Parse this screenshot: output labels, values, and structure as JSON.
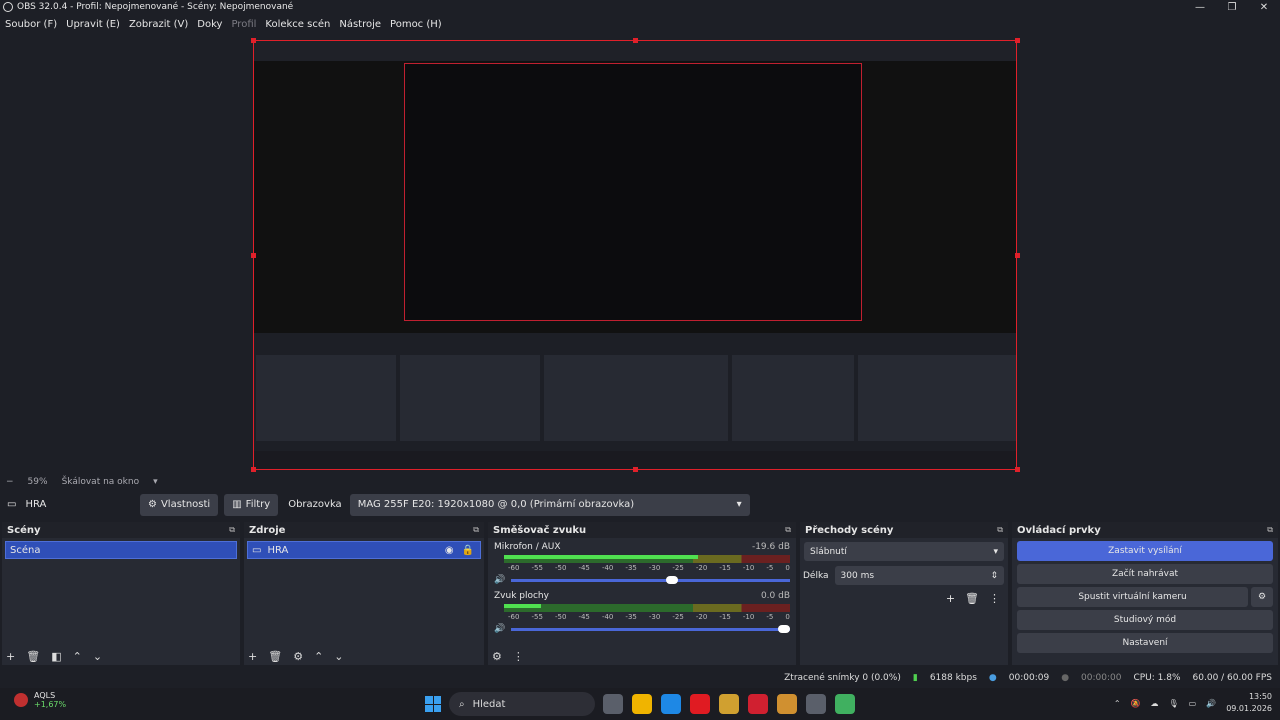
{
  "window": {
    "title": "OBS 32.0.4 - Profil: Nepojmenované - Scény: Nepojmenované",
    "buttons": [
      "—",
      "❐",
      "✕"
    ]
  },
  "menu": [
    {
      "label": "Soubor (F)",
      "dim": false
    },
    {
      "label": "Upravit (E)",
      "dim": false
    },
    {
      "label": "Zobrazit (V)",
      "dim": false
    },
    {
      "label": "Doky",
      "dim": false
    },
    {
      "label": "Profil",
      "dim": true
    },
    {
      "label": "Kolekce scén",
      "dim": false
    },
    {
      "label": "Nástroje",
      "dim": false
    },
    {
      "label": "Pomoc (H)",
      "dim": false
    }
  ],
  "preview": {
    "zoom": "59%",
    "scale_mode": "Škálovat na okno"
  },
  "source_bar": {
    "source_name": "HRA",
    "properties": "Vlastnosti",
    "filters": "Filtry",
    "display_label": "Obrazovka",
    "display_value": "MAG 255F E20: 1920x1080 @ 0,0 (Primární obrazovka)"
  },
  "scenes": {
    "title": "Scény",
    "items": [
      "Scéna"
    ]
  },
  "sources": {
    "title": "Zdroje",
    "items": [
      "HRA"
    ]
  },
  "mixer": {
    "title": "Směšovač zvuku",
    "channels": [
      {
        "name": "Mikrofon / AUX",
        "db": "-19.6 dB",
        "level": 0.68,
        "volume": 0.6
      },
      {
        "name": "Zvuk plochy",
        "db": "0.0 dB",
        "level": 0.13,
        "volume": 1.0
      }
    ],
    "ticks": [
      "-60",
      "-55",
      "-50",
      "-45",
      "-40",
      "-35",
      "-30",
      "-25",
      "-20",
      "-15",
      "-10",
      "-5",
      "0"
    ]
  },
  "transitions": {
    "title": "Přechody scény",
    "type": "Slábnutí",
    "duration_label": "Délka",
    "duration": "300 ms"
  },
  "controls": {
    "title": "Ovládací prvky",
    "stop_stream": "Zastavit vysílání",
    "start_record": "Začít nahrávat",
    "virtual_cam": "Spustit virtuální kameru",
    "studio_mode": "Studiový mód",
    "settings": "Nastavení"
  },
  "status": {
    "dropped": "Ztracené snímky 0 (0.0%)",
    "bitrate": "6188 kbps",
    "stream_time": "00:00:09",
    "rec_time": "00:00:00",
    "cpu": "CPU: 1.8%",
    "fps": "60.00 / 60.00 FPS"
  },
  "taskbar": {
    "weather_name": "AQLS",
    "weather_change": "+1,67%",
    "search_placeholder": "Hledat",
    "time": "13:50",
    "date": "09.01.2026",
    "app_colors": [
      "#5a5f6a",
      "#f0b400",
      "#1e88e5",
      "#e01b22",
      "#d0a030",
      "#d02030",
      "#d09030",
      "#5a5f6a",
      "#40b060"
    ]
  },
  "colors": {
    "accent": "#4a67d8",
    "selection_red": "#e0202a"
  }
}
